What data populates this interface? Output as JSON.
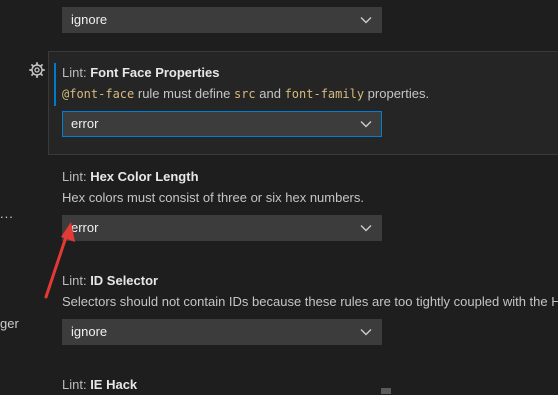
{
  "left_panel": {
    "ellipsis": "...",
    "clipped_text": "ger"
  },
  "settings": [
    {
      "dropdown_value": "ignore"
    },
    {
      "category": "Lint: ",
      "name": "Font Face Properties",
      "description": {
        "code1": "@font-face",
        "text1": " rule must define ",
        "code2": "src",
        "text2": " and ",
        "code3": "font-family",
        "text3": " properties."
      },
      "dropdown_value": "error"
    },
    {
      "category": "Lint: ",
      "name": "Hex Color Length",
      "description": "Hex colors must consist of three or six hex numbers.",
      "dropdown_value": "error"
    },
    {
      "category": "Lint: ",
      "name": "ID Selector",
      "description": "Selectors should not contain IDs because these rules are too tightly coupled with the HTML.",
      "dropdown_value": "ignore"
    },
    {
      "category": "Lint: ",
      "name": "IE Hack"
    }
  ],
  "icons": {
    "gear": "gear-icon",
    "chevron": "chevron-down-icon",
    "annotation_arrow": "red-arrow-annotation"
  },
  "colors": {
    "background": "#1e1e1e",
    "focused_row": "#252526",
    "focus_border": "#007fd4",
    "dropdown_bg": "#3c3c3c",
    "annotation": "#e53935"
  }
}
